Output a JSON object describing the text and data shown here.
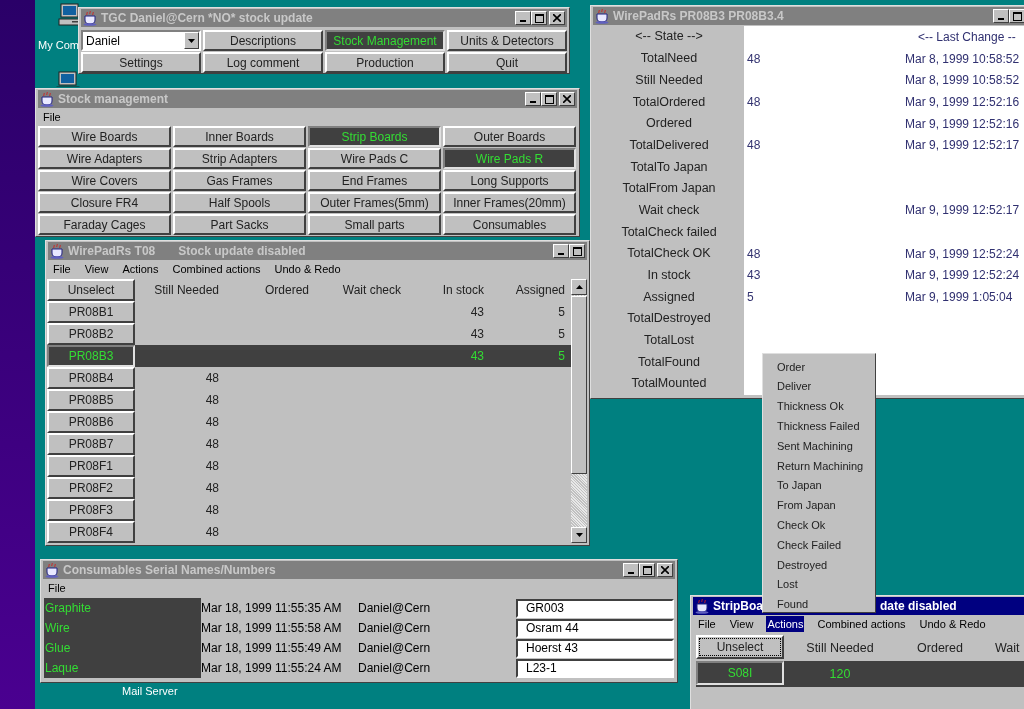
{
  "desktop": {
    "icons": [
      {
        "kind": "computer",
        "label": "My Com"
      },
      {
        "kind": "computer"
      },
      {
        "label": "Mail Server"
      }
    ]
  },
  "main_window": {
    "title": "TGC Daniel@Cern *NO* stock update",
    "user": "Daniel",
    "buttons": [
      {
        "label": "Descriptions",
        "selected": false
      },
      {
        "label": "Stock Management",
        "selected": true
      },
      {
        "label": "Units & Detectors",
        "selected": false
      },
      {
        "label": "Settings",
        "selected": false
      },
      {
        "label": "Log comment",
        "selected": false
      },
      {
        "label": "Production",
        "selected": false
      },
      {
        "label": "Quit",
        "selected": false
      }
    ]
  },
  "stock_window": {
    "title": "Stock management",
    "menu": [
      "File"
    ],
    "buttons": [
      {
        "label": "Wire Boards",
        "selected": false
      },
      {
        "label": "Inner Boards",
        "selected": false
      },
      {
        "label": "Strip Boards",
        "selected": true
      },
      {
        "label": "Outer Boards",
        "selected": false
      },
      {
        "label": "Wire Adapters",
        "selected": false
      },
      {
        "label": "Strip Adapters",
        "selected": false
      },
      {
        "label": "Wire Pads C",
        "selected": false
      },
      {
        "label": "Wire Pads R",
        "selected": true
      },
      {
        "label": "Wire Covers",
        "selected": false
      },
      {
        "label": "Gas Frames",
        "selected": false
      },
      {
        "label": "End Frames",
        "selected": false
      },
      {
        "label": "Long Supports",
        "selected": false
      },
      {
        "label": "Closure FR4",
        "selected": false
      },
      {
        "label": "Half Spools",
        "selected": false
      },
      {
        "label": "Outer Frames(5mm)",
        "selected": false
      },
      {
        "label": "Inner Frames(20mm)",
        "selected": false
      },
      {
        "label": "Faraday Cages",
        "selected": false
      },
      {
        "label": "Part Sacks",
        "selected": false
      },
      {
        "label": "Small parts",
        "selected": false
      },
      {
        "label": "Consumables",
        "selected": false
      }
    ]
  },
  "table_window": {
    "title": "WirePadRs T08",
    "status": "Stock update disabled",
    "menu": [
      "File",
      "View",
      "Actions",
      "Combined actions",
      "Undo & Redo"
    ],
    "columns": [
      "Unselect",
      "Still Needed",
      "Ordered",
      "Wait check",
      "In stock",
      "Assigned"
    ],
    "rows": [
      {
        "name": "PR08B1",
        "selected": false,
        "in_stock": "43",
        "assigned": "5"
      },
      {
        "name": "PR08B2",
        "selected": false,
        "in_stock": "43",
        "assigned": "5"
      },
      {
        "name": "PR08B3",
        "selected": true,
        "in_stock": "43",
        "assigned": "5"
      },
      {
        "name": "PR08B4",
        "selected": false,
        "still_needed": "48"
      },
      {
        "name": "PR08B5",
        "selected": false,
        "still_needed": "48"
      },
      {
        "name": "PR08B6",
        "selected": false,
        "still_needed": "48"
      },
      {
        "name": "PR08B7",
        "selected": false,
        "still_needed": "48"
      },
      {
        "name": "PR08F1",
        "selected": false,
        "still_needed": "48"
      },
      {
        "name": "PR08F2",
        "selected": false,
        "still_needed": "48"
      },
      {
        "name": "PR08F3",
        "selected": false,
        "still_needed": "48"
      },
      {
        "name": "PR08F4",
        "selected": false,
        "still_needed": "48"
      }
    ]
  },
  "detail_window": {
    "title": "WirePadRs PR08B3 PR08B3.4",
    "state_header": "<-- State -->",
    "change_header": "<-- Last Change --",
    "rows": [
      {
        "state": "TotalNeed",
        "value": "48",
        "changed": "Mar 8, 1999 10:58:52"
      },
      {
        "state": "Still Needed",
        "changed": "Mar 8, 1999 10:58:52"
      },
      {
        "state": "TotalOrdered",
        "value": "48",
        "changed": "Mar 9, 1999 12:52:16"
      },
      {
        "state": "Ordered",
        "changed": "Mar 9, 1999 12:52:16"
      },
      {
        "state": "TotalDelivered",
        "value": "48",
        "changed": "Mar 9, 1999 12:52:17"
      },
      {
        "state": "TotalTo Japan"
      },
      {
        "state": "TotalFrom Japan"
      },
      {
        "state": "Wait check",
        "changed": "Mar 9, 1999 12:52:17"
      },
      {
        "state": "TotalCheck failed"
      },
      {
        "state": "TotalCheck OK",
        "value": "48",
        "changed": "Mar 9, 1999 12:52:24"
      },
      {
        "state": "In stock",
        "value": "43",
        "changed": "Mar 9, 1999 12:52:24"
      },
      {
        "state": "Assigned",
        "value": "5",
        "changed": "Mar 9, 1999 1:05:04"
      },
      {
        "state": "TotalDestroyed"
      },
      {
        "state": "TotalLost"
      },
      {
        "state": "TotalFound"
      },
      {
        "state": "TotalMounted"
      }
    ]
  },
  "consumables_window": {
    "title": "Consumables Serial Names/Numbers",
    "menu": [
      "File"
    ],
    "rows": [
      {
        "name": "Graphite",
        "date": "Mar 18, 1999 11:55:35 AM",
        "user": "Daniel@Cern",
        "serial": "GR003"
      },
      {
        "name": "Wire",
        "date": "Mar 18, 1999 11:55:58 AM",
        "user": "Daniel@Cern",
        "serial": "Osram 44"
      },
      {
        "name": "Glue",
        "date": "Mar 18, 1999 11:55:49 AM",
        "user": "Daniel@Cern",
        "serial": "Hoerst 43"
      },
      {
        "name": "Laque",
        "date": "Mar 18, 1999 11:55:24 AM",
        "user": "Daniel@Cern",
        "serial": "L23-1"
      }
    ]
  },
  "strip_window": {
    "title_start": "StripBoa",
    "title_end": "date disabled",
    "active": true,
    "menu": [
      {
        "label": "File",
        "selected": false
      },
      {
        "label": "View",
        "selected": false
      },
      {
        "label": "Actions",
        "selected": true
      },
      {
        "label": "Combined actions",
        "selected": false
      },
      {
        "label": "Undo & Redo",
        "selected": false
      }
    ],
    "columns": [
      "Unselect",
      "Still Needed",
      "Ordered",
      "Wait"
    ],
    "rows": [
      {
        "name": "S08I",
        "selected": true,
        "still_needed": "120"
      }
    ]
  },
  "actions_menu": {
    "items": [
      "Order",
      "Deliver",
      "Thickness Ok",
      "Thickness Failed",
      "Sent Machining",
      "Return Machining",
      "To Japan",
      "From Japan",
      "Check Ok",
      "Check Failed",
      "Destroyed",
      "Lost",
      "Found"
    ]
  }
}
